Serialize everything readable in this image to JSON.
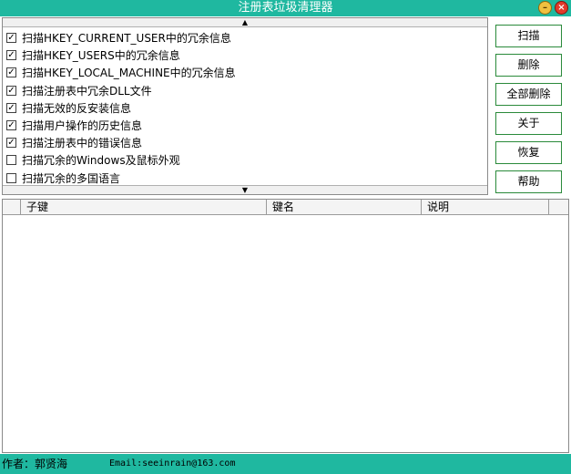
{
  "window": {
    "title": "注册表垃圾清理器",
    "minimize_glyph": "–",
    "close_glyph": "×"
  },
  "scan_options": {
    "scroll_up_glyph": "▲",
    "scroll_down_glyph": "▼",
    "checked_glyph": "✓",
    "items": [
      {
        "label": "扫描HKEY_CURRENT_USER中的冗余信息",
        "checked": true
      },
      {
        "label": "扫描HKEY_USERS中的冗余信息",
        "checked": true
      },
      {
        "label": "扫描HKEY_LOCAL_MACHINE中的冗余信息",
        "checked": true
      },
      {
        "label": "扫描注册表中冗余DLL文件",
        "checked": true
      },
      {
        "label": "扫描无效的反安装信息",
        "checked": true
      },
      {
        "label": "扫描用户操作的历史信息",
        "checked": true
      },
      {
        "label": "扫描注册表中的错误信息",
        "checked": true
      },
      {
        "label": "扫描冗余的Windows及鼠标外观",
        "checked": false
      },
      {
        "label": "扫描冗余的多国语言",
        "checked": false
      }
    ]
  },
  "buttons": {
    "scan": "扫描",
    "delete": "删除",
    "delete_all": "全部删除",
    "about": "关于",
    "restore": "恢复",
    "help": "帮助"
  },
  "results_table": {
    "columns": [
      "子键",
      "键名",
      "说明"
    ],
    "rows": []
  },
  "status": {
    "author": "作者：郭贤海",
    "email": "Email:seeinrain@163.com"
  },
  "colors": {
    "accent": "#1fb8a0",
    "button_border": "#2a8a3a"
  }
}
